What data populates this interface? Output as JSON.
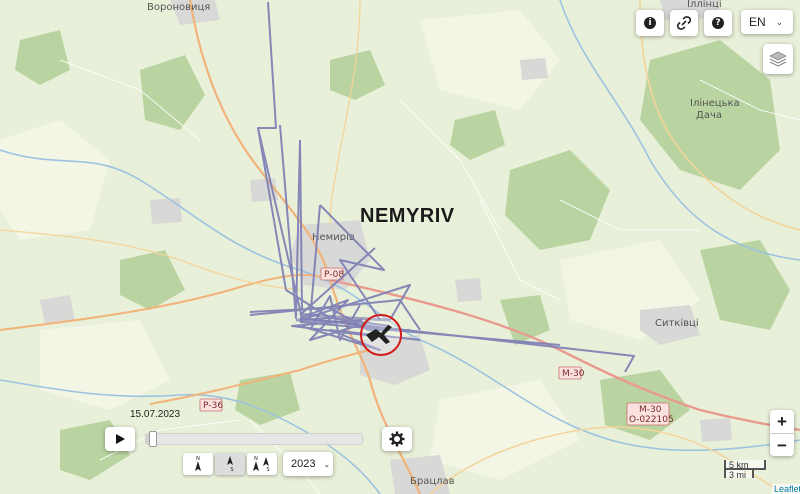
{
  "map": {
    "city_label": "NEMYRIV",
    "places": {
      "voronovytsia": "Вороновиця",
      "nemyriv": "Немирів",
      "illintsi": "Іллінці",
      "ilyntsetska_dacha": "Ілінецька\nДача",
      "sytkivtsi": "Ситківці",
      "bratslav": "Брацлав"
    },
    "roads": {
      "r08": "Р-08",
      "r36": "Р-36",
      "m30": "М-30",
      "m30_stack": "М-30",
      "o022105": "О-022105"
    },
    "track_color": "#7d7fb5",
    "marker_color": "#d11a1a"
  },
  "controls": {
    "info_icon": "i",
    "link_icon": "link-icon",
    "help_icon": "?",
    "language": "EN"
  },
  "playback": {
    "date": "15.07.2023",
    "year": "2023",
    "progress": 0.02
  },
  "compass": {
    "n": "N",
    "s": "S"
  },
  "scale": {
    "km": "5 km",
    "mi": "3 mi"
  },
  "attribution": "Leaflet"
}
